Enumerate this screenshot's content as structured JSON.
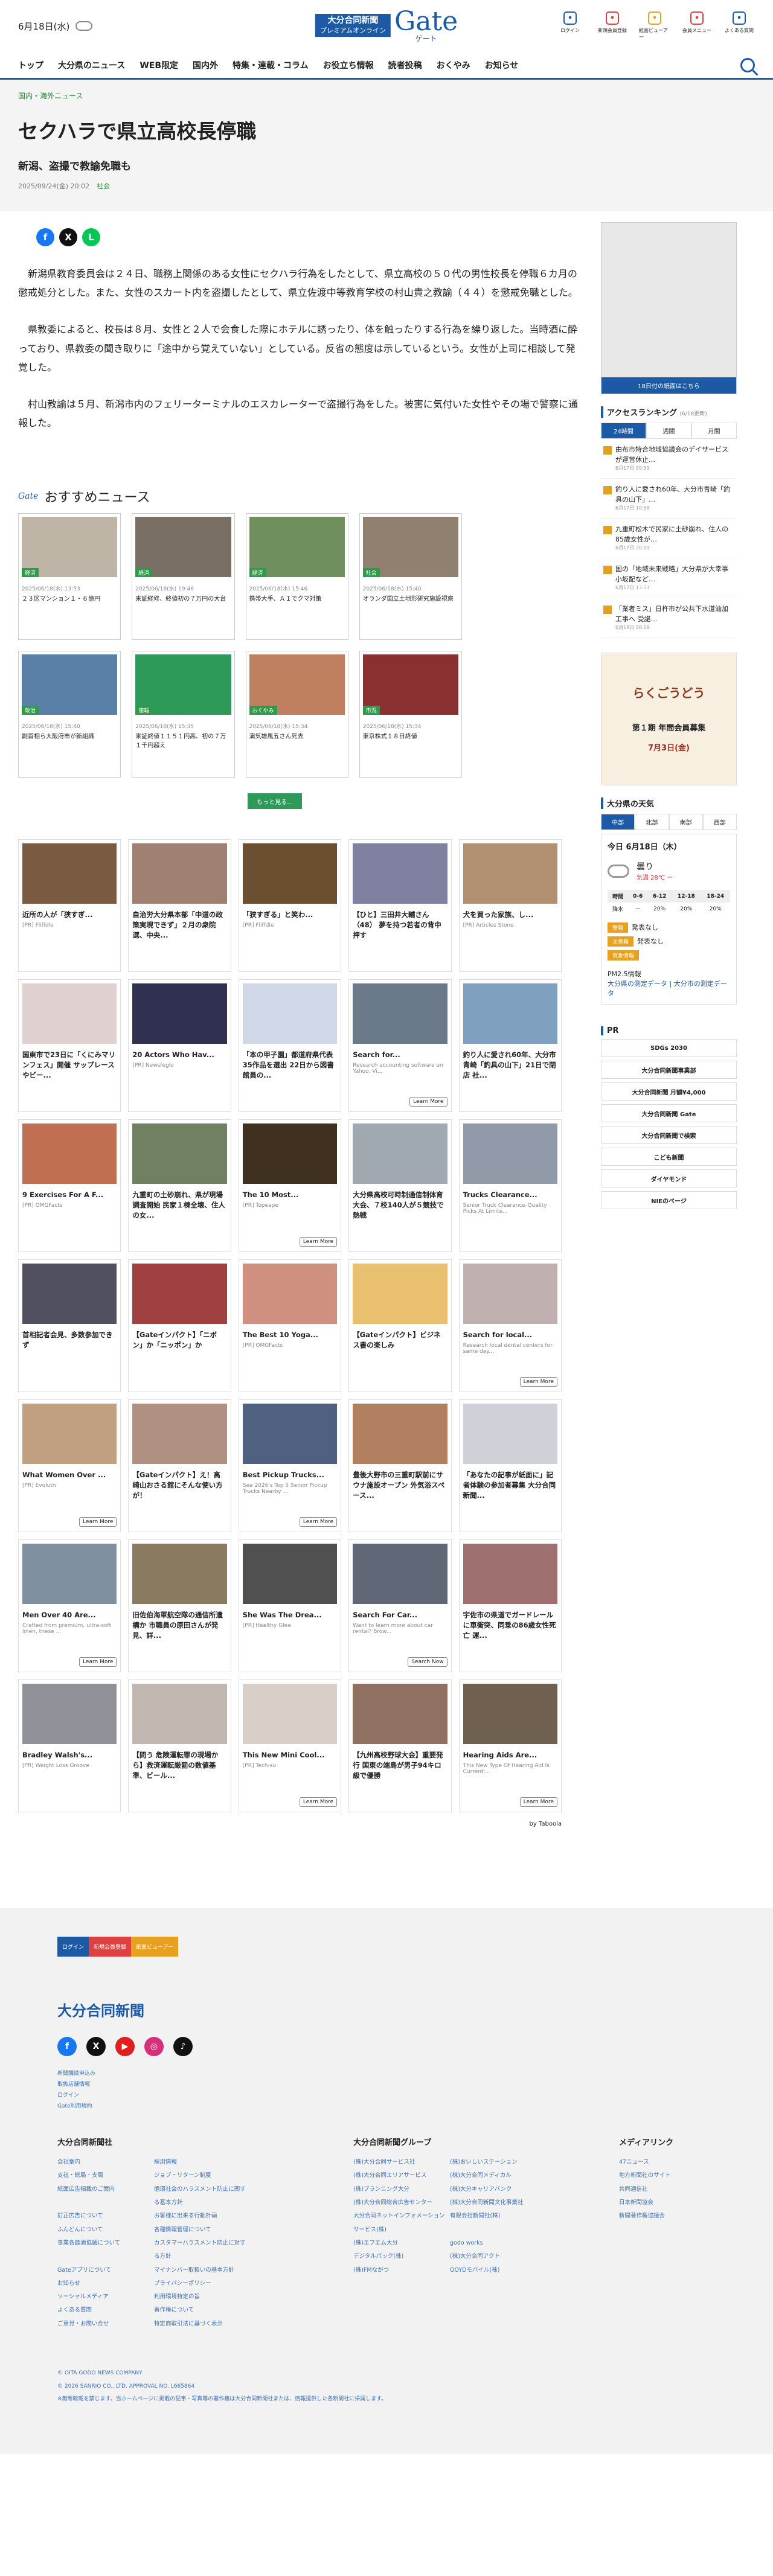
{
  "header": {
    "date": "6月18日(水)",
    "logo_top": "大分合同新聞",
    "logo_sub": "プレミアムオンライン",
    "logo_gate": "Gate",
    "logo_kana": "ゲート",
    "icons": [
      {
        "label": "ログイン",
        "icon": "login-icon",
        "color": "#1d5aa6"
      },
      {
        "label": "新規会員登録",
        "icon": "check-icon",
        "color": "#e04040"
      },
      {
        "label": "紙面ビューアー",
        "icon": "paper-icon",
        "color": "#e8a020"
      },
      {
        "label": "会員メニュー",
        "icon": "user-icon",
        "color": "#e04040"
      },
      {
        "label": "よくある質問",
        "icon": "question-icon",
        "color": "#1d5aa6"
      }
    ]
  },
  "nav": [
    "トップ",
    "大分県のニュース",
    "WEB限定",
    "国内外",
    "特集・連載・コラム",
    "お役立ち情報",
    "読者投稿",
    "おくやみ",
    "お知らせ"
  ],
  "article": {
    "crumb": "国内・海外ニュース",
    "title": "セクハラで県立高校長停職",
    "subtitle": "新潟、盗撮で教諭免職も",
    "date": "2025/09/24(金) 20:02",
    "category": "社会",
    "paragraphs": [
      "新潟県教育委員会は２４日、職務上関係のある女性にセクハラ行為をしたとして、県立高校の５０代の男性校長を停職６カ月の懲戒処分とした。また、女性のスカート内を盗撮したとして、県立佐渡中等教育学校の村山貴之教諭（４４）を懲戒免職とした。",
      "県教委によると、校長は８月、女性と２人で会食した際にホテルに誘ったり、体を触ったりする行為を繰り返した。当時酒に酔っており、県教委の聞き取りに「途中から覚えていない」としている。反省の態度は示しているという。女性が上司に相談して発覚した。",
      "村山教諭は５月、新潟市内のフェリーターミナルのエスカレーターで盗撮行為をした。被害に気付いた女性やその場で警察に通報した。"
    ]
  },
  "share": [
    {
      "icon": "facebook-icon",
      "glyph": "f",
      "color": "#1877f2"
    },
    {
      "icon": "x-icon",
      "glyph": "X",
      "color": "#111111"
    },
    {
      "icon": "line-icon",
      "glyph": "L",
      "color": "#06c755"
    }
  ],
  "recommend": {
    "logo": "Gate",
    "heading": "おすすめニュース",
    "more": "もっと見る...",
    "items": [
      {
        "tag": "経済",
        "date": "2025/06/18(水) 13:53",
        "title": "２３区マンション１・６億円",
        "color": "#bfb5a6"
      },
      {
        "tag": "経済",
        "date": "2025/06/18(水) 19:46",
        "title": "来証経修、終値初の７万円の大台",
        "color": "#7a6f64"
      },
      {
        "tag": "経済",
        "date": "2025/06/18(水) 15:46",
        "title": "携帯大手、ＡＩでクマ対策",
        "color": "#6f8f5f"
      },
      {
        "tag": "社会",
        "date": "2025/06/18(水) 15:40",
        "title": "オランダ国立土地形研究施設視察",
        "color": "#8f8070"
      },
      {
        "tag": "政治",
        "date": "2025/06/18(水) 15:40",
        "title": "副首相ら大阪府市が新組織",
        "color": "#5a7fa6"
      },
      {
        "tag": "速報",
        "date": "2025/06/18(水) 15:35",
        "title": "来証終値１１５１円高、初の７万１千円超え",
        "color": "#2e9a5a"
      },
      {
        "tag": "おくやみ",
        "date": "2025/06/18(水) 15:34",
        "title": "演気雄風五さん死去",
        "color": "#c08060"
      },
      {
        "tag": "市況",
        "date": "2025/06/18(水) 15:34",
        "title": "東京株式１８日終値",
        "color": "#8a3030"
      }
    ]
  },
  "taboola": {
    "by": "by Taboola",
    "items": [
      {
        "title": "近所の人が「狭すぎ...",
        "src": "[PR] Fliffdle",
        "color": "#7a5a40"
      },
      {
        "title": "自治労大分県本部「中道の政策実現できず」２月の衆院選、中央...",
        "src": "",
        "color": "#a08070"
      },
      {
        "title": "「狭すぎる」と笑わ...",
        "src": "[PR] Fliffdle",
        "color": "#6a5030"
      },
      {
        "title": "【ひと】三田井大輔さん（48） 夢を持つ若者の背中押す",
        "src": "",
        "color": "#8080a0"
      },
      {
        "title": "犬を買った家族、し...",
        "src": "[PR] Articles Stone",
        "color": "#b09070"
      },
      {
        "title": "国東市で23日に「くにみマリンフェス」開催 サップレースやビー...",
        "src": "",
        "color": "#e0d0d0"
      },
      {
        "title": "20 Actors Who Hav...",
        "src": "[PR] Newsfeglo",
        "color": "#303050"
      },
      {
        "title": "「本の甲子園」都道府県代表35作品を選出 22日から図書館員の...",
        "src": "",
        "color": "#d0d8e8"
      },
      {
        "title": "Search for...",
        "src": "Research accounting software on Yahoo. Vi...",
        "color": "#6a7a8a",
        "lm": "Learn More"
      },
      {
        "title": "釣り人に愛され60年、大分市青崎「釣具の山下」21日で閉店 社...",
        "src": "",
        "color": "#80a0c0"
      },
      {
        "title": "9 Exercises For A F...",
        "src": "[PR] OMGFacts",
        "color": "#c07050"
      },
      {
        "title": "九重町の土砂崩れ、県が現場調査開始 民家１棟全壊、住人の女...",
        "src": "",
        "color": "#708060"
      },
      {
        "title": "The 10 Most...",
        "src": "[PR] Topeape",
        "color": "#403020",
        "lm": "Learn More"
      },
      {
        "title": "大分県高校可時制通信制体育大会、７校140人が５競技で熱戦",
        "src": "",
        "color": "#a0a8b0"
      },
      {
        "title": "Trucks Clearance...",
        "src": "Senior Truck Clearance-Quality Picks At Limite...",
        "color": "#909aa8"
      },
      {
        "title": "首相記者会見、多数参加できず",
        "src": "",
        "color": "#505060"
      },
      {
        "title": "【Gateインパクト】「ニボン」か「ニッポン」か",
        "src": "",
        "color": "#a04040"
      },
      {
        "title": "The Best 10 Yoga...",
        "src": "[PR] OMGFacts",
        "color": "#d09080"
      },
      {
        "title": "【Gateインパクト】ビジネス書の楽しみ",
        "src": "",
        "color": "#e8c070"
      },
      {
        "title": "Search for local...",
        "src": "Research local dental centers for same day...",
        "color": "#c0b0b0",
        "lm": "Learn More"
      },
      {
        "title": "What Women Over ...",
        "src": "[PR] Evolutn",
        "color": "#c0a080",
        "lm": "Learn More"
      },
      {
        "title": "【Gateインパクト】え！高崎山おさる館にそんな使い方が！",
        "src": "",
        "color": "#b09080"
      },
      {
        "title": "Best Pickup Trucks...",
        "src": "See 2026's Top 5 Senior Pickup Trucks Nearby ...",
        "color": "#506080",
        "lm": "Learn More"
      },
      {
        "title": "豊後大野市の三重町駅前にサウナ施設オープン 外気浴スペース...",
        "src": "",
        "color": "#b08060"
      },
      {
        "title": "「あなたの記事が紙面に」記者体験の参加者募集 大分合同新聞...",
        "src": "",
        "color": "#d0d0d8"
      },
      {
        "title": "Men Over 40 Are...",
        "src": "Crafted from premium, ultra-soft linen, these ...",
        "color": "#8090a0",
        "lm": "Learn More"
      },
      {
        "title": "旧佐伯海軍航空隊の通信所遺構か 市職員の原田さんが発見、詳...",
        "src": "",
        "color": "#8a7a60"
      },
      {
        "title": "She Was The Drea...",
        "src": "[PR] Healthy Glee",
        "color": "#505050"
      },
      {
        "title": "Search For Car...",
        "src": "Want to learn more about car rental? Brow...",
        "color": "#606878",
        "lm": "Search Now"
      },
      {
        "title": "宇佐市の県道でガードレールに車衝突、同乗の86歳女性死亡 運...",
        "src": "",
        "color": "#a07070"
      },
      {
        "title": "Bradley Walsh's...",
        "src": "[PR] Weight Loss Groove",
        "color": "#909098"
      },
      {
        "title": "【問う 危険運転罪の現場から】救済運転厳罰の数値基準、ビール...",
        "src": "",
        "color": "#c0b8b0"
      },
      {
        "title": "This New Mini Cool...",
        "src": "[PR] Tech-su",
        "color": "#d8d0c8",
        "lm": "Learn More"
      },
      {
        "title": "【九州高校野球大会】重要発行 国東の端島が男子94キロ級で優勝",
        "src": "",
        "color": "#907060"
      },
      {
        "title": "Hearing Aids Are...",
        "src": "This New Type Of Hearing Aid Is Currentl...",
        "color": "#706050",
        "lm": "Learn More"
      }
    ]
  },
  "sidebar": {
    "paper_button": "18日付の紙面はこちら",
    "ranking_title": "アクセスランキング",
    "ranking_date": "(6/18更新)",
    "ranking_tabs": [
      "24時間",
      "週間",
      "月間"
    ],
    "ranking": [
      {
        "t": "由布市特合地域協議会のデイサービスが運営休止…",
        "d": "6月17日 09:59"
      },
      {
        "t": "釣り人に愛され60年、大分市青崎「釣具の山下」…",
        "d": "6月17日 10:56"
      },
      {
        "t": "九重町松木で民家に土砂崩れ、住人の85歳女性が…",
        "d": "6月17日 20:09"
      },
      {
        "t": "国の「地域未来戦略」大分県が大幸事小坂配など…",
        "d": "6月17日 13:33"
      },
      {
        "t": "「業者ミス」日杵市が公共下水道油加工事へ 受諾…",
        "d": "6月18日 08:09"
      }
    ],
    "ad_title": "らくごうどう",
    "ad_sub": "第１期 年間会員募集",
    "ad_date": "7月3日(金)",
    "weather_title": "大分県の天気",
    "weather_tabs": [
      "中部",
      "北部",
      "南部",
      "西部"
    ],
    "weather_date": "今日 6月18日（木）",
    "weather_desc": "曇り",
    "weather_temp": "気温 28℃ ー",
    "times": [
      "時間",
      "0-6",
      "6-12",
      "12-18",
      "18-24"
    ],
    "rain": [
      "降水",
      "ー",
      "20%",
      "20%",
      "20%"
    ],
    "alerts": [
      {
        "l": "警報",
        "v": "発表なし"
      },
      {
        "l": "注意報",
        "v": "発表なし"
      },
      {
        "l": "気象情報",
        "v": ""
      }
    ],
    "pm_title": "PM2.5情報",
    "pm_links": "大分県の測定データ | 大分市の測定データ",
    "pr": "PR",
    "pr_items": [
      "SDGs 2030",
      "大分合同新聞事業部",
      "大分合同新聞 月額¥4,000",
      "大分合同新聞 Gate",
      "大分合同新聞で検索",
      "こども新聞",
      "ダイヤモンド",
      "NIEのページ"
    ]
  },
  "footer": {
    "btns": [
      {
        "l": "ログイン",
        "c": "#1d5aa6"
      },
      {
        "l": "新規会員登録",
        "c": "#e04040"
      },
      {
        "l": "紙面ビューアー",
        "c": "#e8a020"
      }
    ],
    "title": "大分合同新聞",
    "links": [
      "新聞購読申込み",
      "取扱店舗情報",
      "ログイン",
      "Gate利用規約"
    ],
    "col1_title": "大分合同新聞社",
    "col1": [
      "会社案内",
      "採用情報",
      "支社・総局・支局",
      "ジョブ・リターン制度",
      "紙面広告掲載のご案内",
      "循環社会のハラスメント防止に関する基本方針",
      "訂正広告について",
      "お客様に出来る行動計画",
      "ふんどんについて",
      "各種情報管理について",
      "事業各最適協議について",
      "カスタマーハラスメント防止に対する方針",
      "Gateアプリについて",
      "マイナンバー取扱いの基本方針",
      "お知らせ",
      "プライバシーポリシー",
      "ソーシャルメディア",
      "利用環境特定の旨",
      "よくある質問",
      "著作権について",
      "ご意見・お問い合せ",
      "特定商取引法に基づく表示"
    ],
    "col2_title": "大分合同新聞グループ",
    "col2": [
      "(株)大分合同サービス社",
      "(株)おいしいステーション",
      "(株)大分合同エリアサービス",
      "(株)大分合同メディカル",
      "(株)ブランニング大分",
      "(株)大分キャリアバンク",
      "(株)大分合同総合広告センター",
      "(株)大分合同新聞文化事業社",
      "大分合同ネットインフォメーションサービス(株)",
      "有限会社新聞社(株)",
      "(株)エフエム大分",
      "godo works",
      "デジタルパック(株)",
      "(株)大分合同アクト",
      "(株)FMながつ",
      "OOYDモバイル(株)"
    ],
    "col3_title": "メディアリンク",
    "col3": [
      "47ニュース",
      "地方新聞社のサイト",
      "共同通信社",
      "日本新聞協会",
      "新聞著作権協議会"
    ],
    "copy": [
      "© OITA GODO NEWS COMPANY",
      "© 2026 SANRIO CO., LTD. APPROVAL NO. L665864",
      "※無断転載を禁じます。当ホームページに掲載の記事・写真等の著作権は大分合同新聞社または、情報提供した各新聞社に帰属します。"
    ]
  }
}
